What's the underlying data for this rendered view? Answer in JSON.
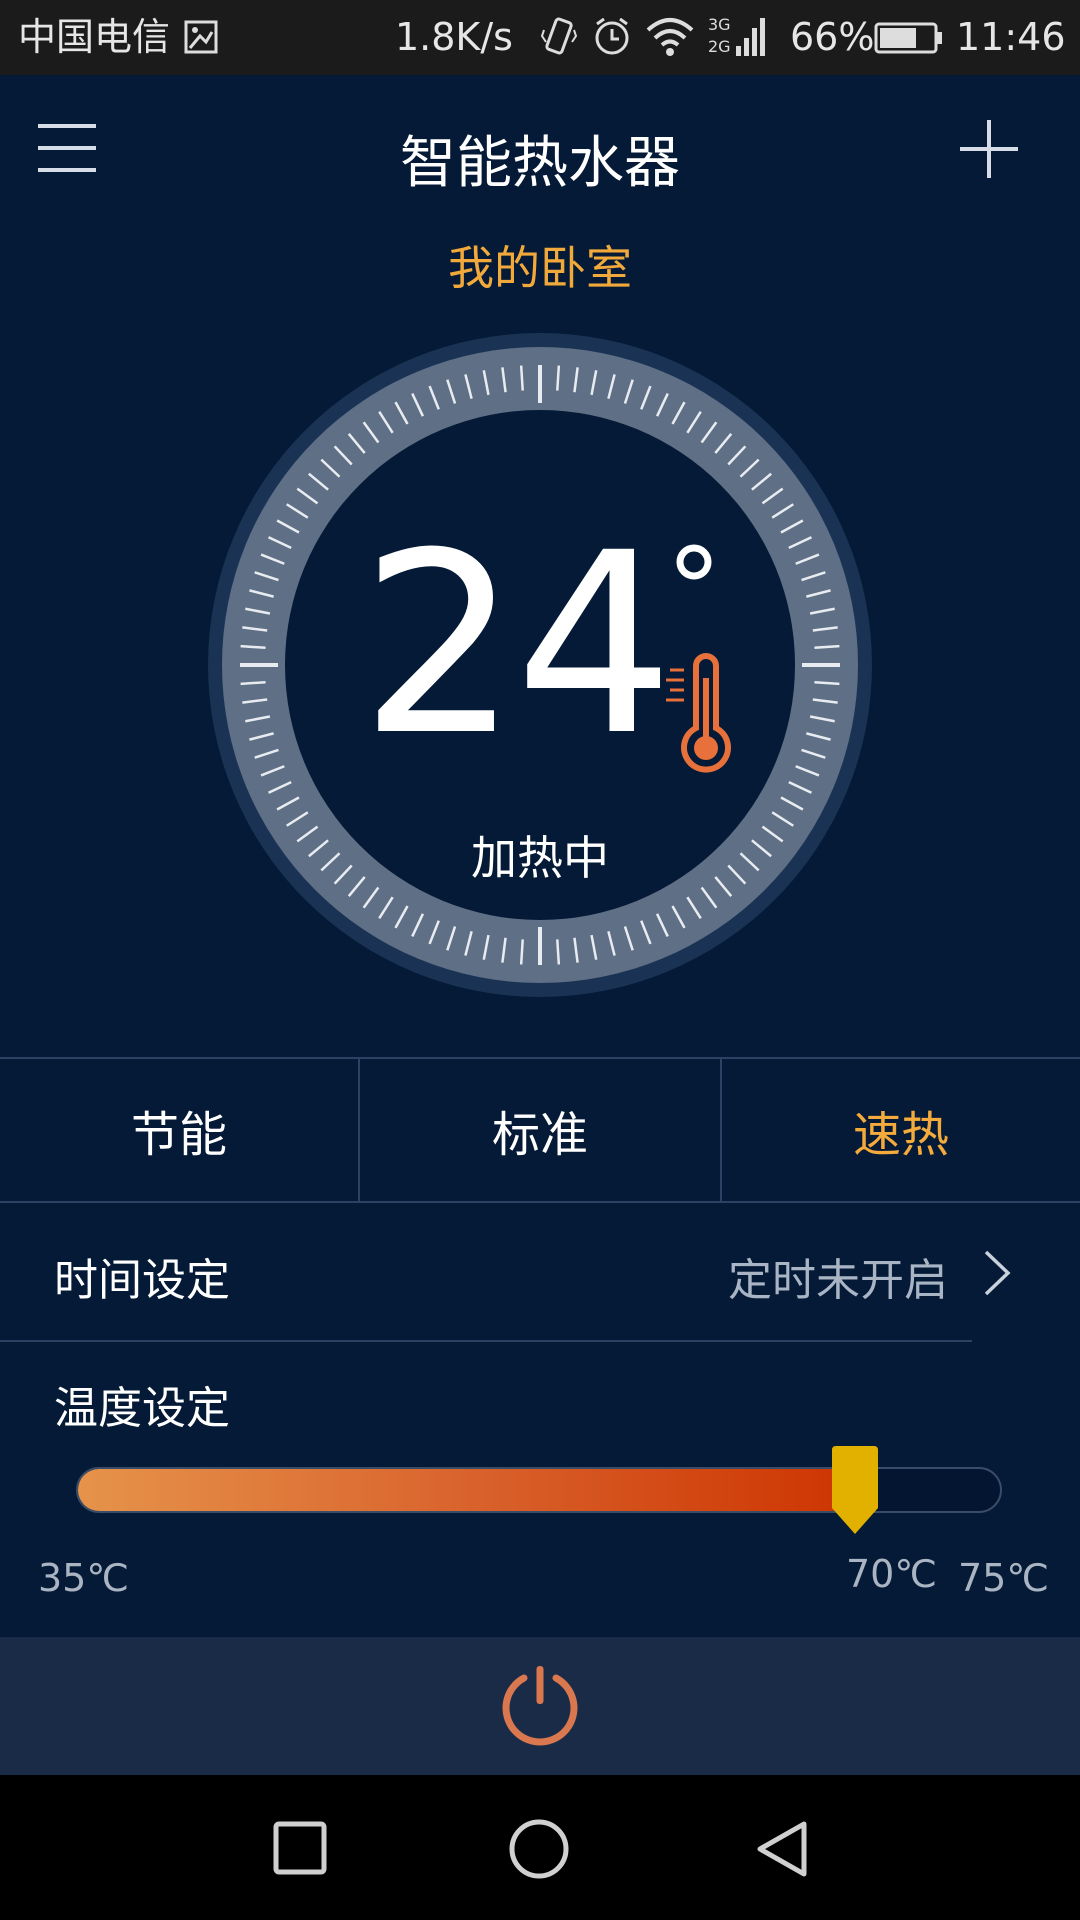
{
  "status_bar": {
    "carrier": "中国电信",
    "net_speed": "1.8K/s",
    "signal_label": "3G\n2G",
    "battery": "66%",
    "time": "11:46"
  },
  "header": {
    "title": "智能热水器",
    "menu_icon": "hamburger-menu-icon",
    "add_icon": "plus-icon"
  },
  "device": {
    "room": "我的卧室",
    "current_temp": "24",
    "status": "加热中"
  },
  "modes": [
    {
      "label": "节能",
      "active": false
    },
    {
      "label": "标准",
      "active": false
    },
    {
      "label": "速热",
      "active": true
    }
  ],
  "time_setting": {
    "label": "时间设定",
    "status": "定时未开启"
  },
  "temp_setting": {
    "label": "温度设定",
    "min_label": "35℃",
    "current_label": "70℃",
    "max_label": "75℃",
    "level": 0.875
  },
  "colors": {
    "accent": "#f5aa3c",
    "background": "#041a36",
    "power": "#d9784f",
    "slider_handle": "#e2b100"
  }
}
